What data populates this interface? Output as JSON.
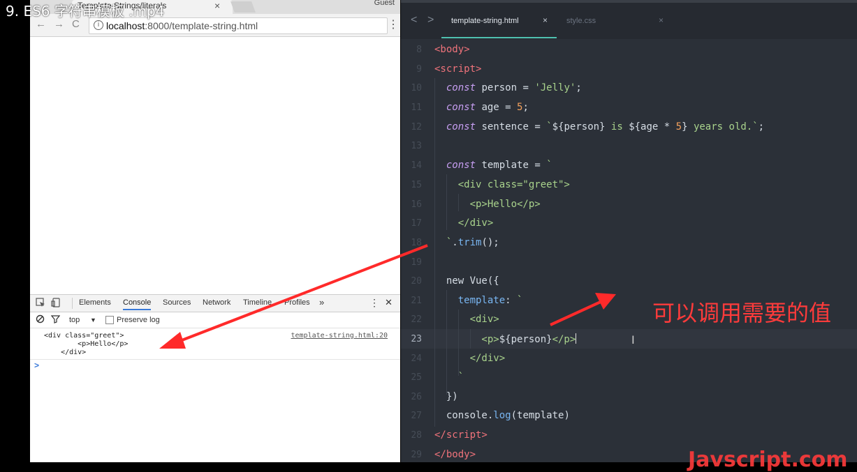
{
  "video": {
    "title": "9. ES6 字符串模板 .mp4"
  },
  "browser": {
    "tab_title": "Template Strings/literals",
    "tab_close": "×",
    "profile": "Guest",
    "back": "←",
    "forward": "→",
    "reload": "C",
    "info_icon": "i",
    "url_host": "localhost",
    "url_rest": ":8000/template-string.html",
    "menu": "⋮"
  },
  "devtools": {
    "tabs": [
      "Elements",
      "Console",
      "Sources",
      "Network",
      "Timeline",
      "Profiles"
    ],
    "active_tab": "Console",
    "more": "»",
    "menu": "⋮",
    "close": "✕",
    "context": "top",
    "context_arrow": "▼",
    "preserve_log": "Preserve log",
    "log_lines": [
      "<div class=\"greet\">",
      "        <p>Hello</p>",
      "    </div>"
    ],
    "log_source": "template-string.html:20",
    "prompt": ">"
  },
  "editor": {
    "back": "<",
    "forward": ">",
    "tabs": [
      {
        "label": "template-string.html",
        "close": "×",
        "active": true
      },
      {
        "label": "style.css",
        "close": "×",
        "active": false
      }
    ],
    "line_numbers": [
      "8",
      "9",
      "10",
      "11",
      "12",
      "13",
      "14",
      "15",
      "16",
      "17",
      "18",
      "19",
      "20",
      "21",
      "22",
      "23",
      "24",
      "25",
      "26",
      "27",
      "28",
      "29"
    ],
    "current_line": "23"
  },
  "annotation": {
    "text": "可以调用需要的值",
    "color": "#ff3b3b"
  },
  "watermark": {
    "text": "Javscript.com"
  },
  "colors": {
    "tag": "#f0737b",
    "keyword": "#c89ff3",
    "string": "#a9d38c",
    "number": "#f5a25d",
    "function": "#79b6f2",
    "accent": "#4fc1b0"
  }
}
